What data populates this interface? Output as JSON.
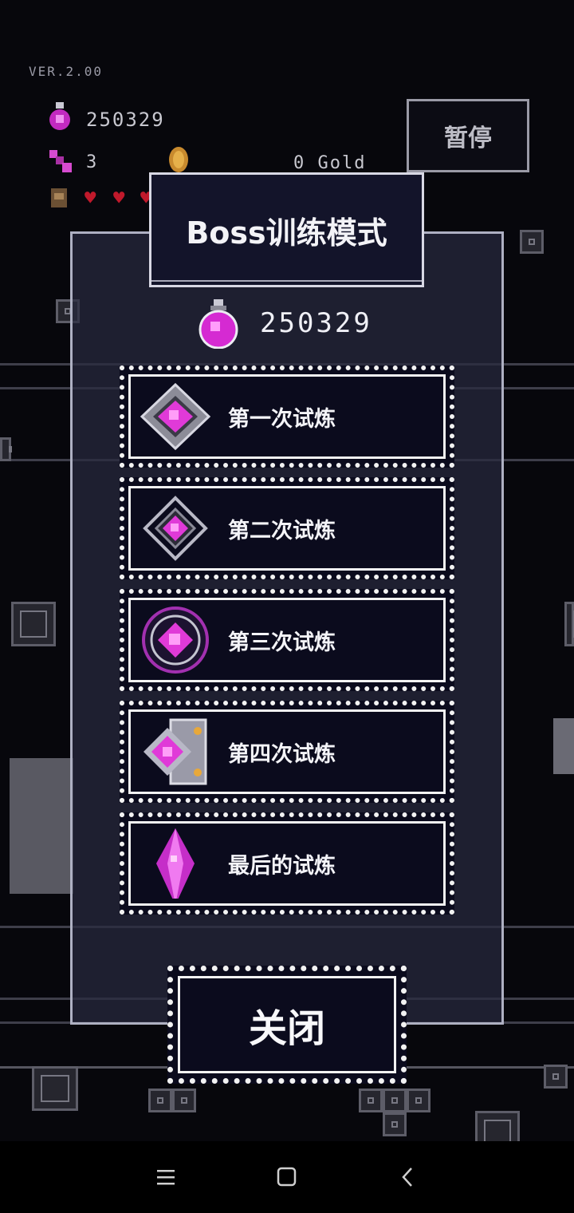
{
  "hud": {
    "version": "VER.2.00",
    "potion_count": "250329",
    "key_count": "3",
    "gold": "0 Gold",
    "pause_label": "暂停",
    "hearts": 3
  },
  "dialog": {
    "title": "Boss训练模式",
    "currency_amount": "250329",
    "trials": [
      {
        "label": "第一次试炼",
        "icon": "square-gem-emblem-icon"
      },
      {
        "label": "第二次试炼",
        "icon": "diamond-gem-emblem-icon"
      },
      {
        "label": "第三次试炼",
        "icon": "circle-gem-emblem-icon"
      },
      {
        "label": "第四次试炼",
        "icon": "scroll-gem-emblem-icon"
      },
      {
        "label": "最后的试炼",
        "icon": "crystal-shard-icon"
      }
    ],
    "close_label": "关闭"
  },
  "navbar": {
    "menu_icon": "menu-icon",
    "home_icon": "home-square-icon",
    "back_icon": "back-chevron-icon"
  },
  "colors": {
    "background": "#07070c",
    "panel_border": "#aeb0c2",
    "gem_magenta": "#e03ad8",
    "heart_red": "#c0192b"
  }
}
